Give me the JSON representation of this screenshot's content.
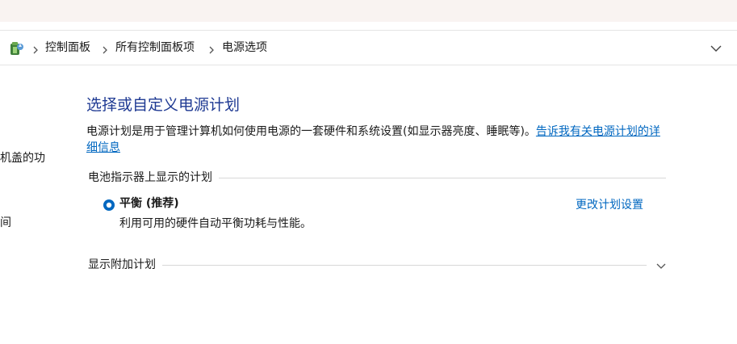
{
  "breadcrumb": {
    "items": [
      "控制面板",
      "所有控制面板项",
      "电源选项"
    ]
  },
  "sidebar": {
    "fragments": [
      "机盖的功",
      "间"
    ]
  },
  "main": {
    "title": "选择或自定义电源计划",
    "description": "电源计划是用于管理计算机如何使用电源的一套硬件和系统设置(如显示器亮度、睡眠等)。",
    "description_link": "告诉我有关电源计划的详细信息",
    "battery_section_label": "电池指示器上显示的计划",
    "plan": {
      "name": "平衡 (推荐)",
      "description": "利用可用的硬件自动平衡功耗与性能。",
      "selected": true,
      "change_link": "更改计划设置"
    },
    "additional_section_label": "显示附加计划"
  },
  "colors": {
    "title": "#1f3a93",
    "link": "#0067c0",
    "radio": "#0067c0",
    "top_strip": "#f9f3f1"
  },
  "icons": {
    "location": "power-options-icon",
    "separator": "chevron-right-icon",
    "address_dropdown": "chevron-down-icon",
    "expand": "chevron-down-icon"
  }
}
